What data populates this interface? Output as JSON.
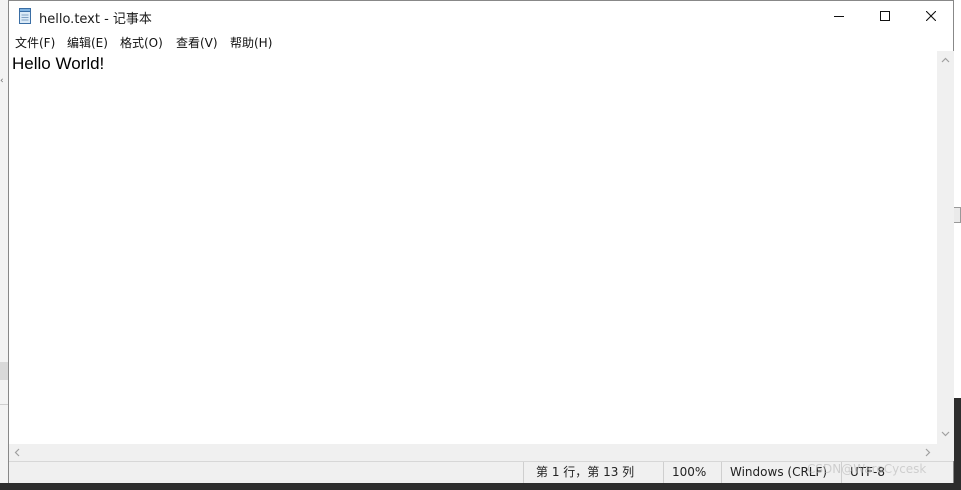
{
  "window": {
    "title": "hello.text - 记事本",
    "app_icon": "notepad-icon",
    "controls": {
      "minimize": "minimize-icon",
      "maximize": "maximize-icon",
      "close": "close-icon"
    }
  },
  "menubar": {
    "items": [
      {
        "label": "文件(F)"
      },
      {
        "label": "编辑(E)"
      },
      {
        "label": "格式(O)"
      },
      {
        "label": "查看(V)"
      },
      {
        "label": "帮助(H)"
      }
    ]
  },
  "editor": {
    "content": "Hello World!"
  },
  "statusbar": {
    "position": "第 1 行，第 13 列",
    "zoom": "100%",
    "line_ending": "Windows (CRLF)",
    "encoding": "UTF-8"
  },
  "watermark": "CSDN@WareCycesk",
  "colors": {
    "chrome_bg": "#f0f0f0",
    "editor_bg": "#ffffff",
    "desktop_dark": "#2d2d2d"
  }
}
